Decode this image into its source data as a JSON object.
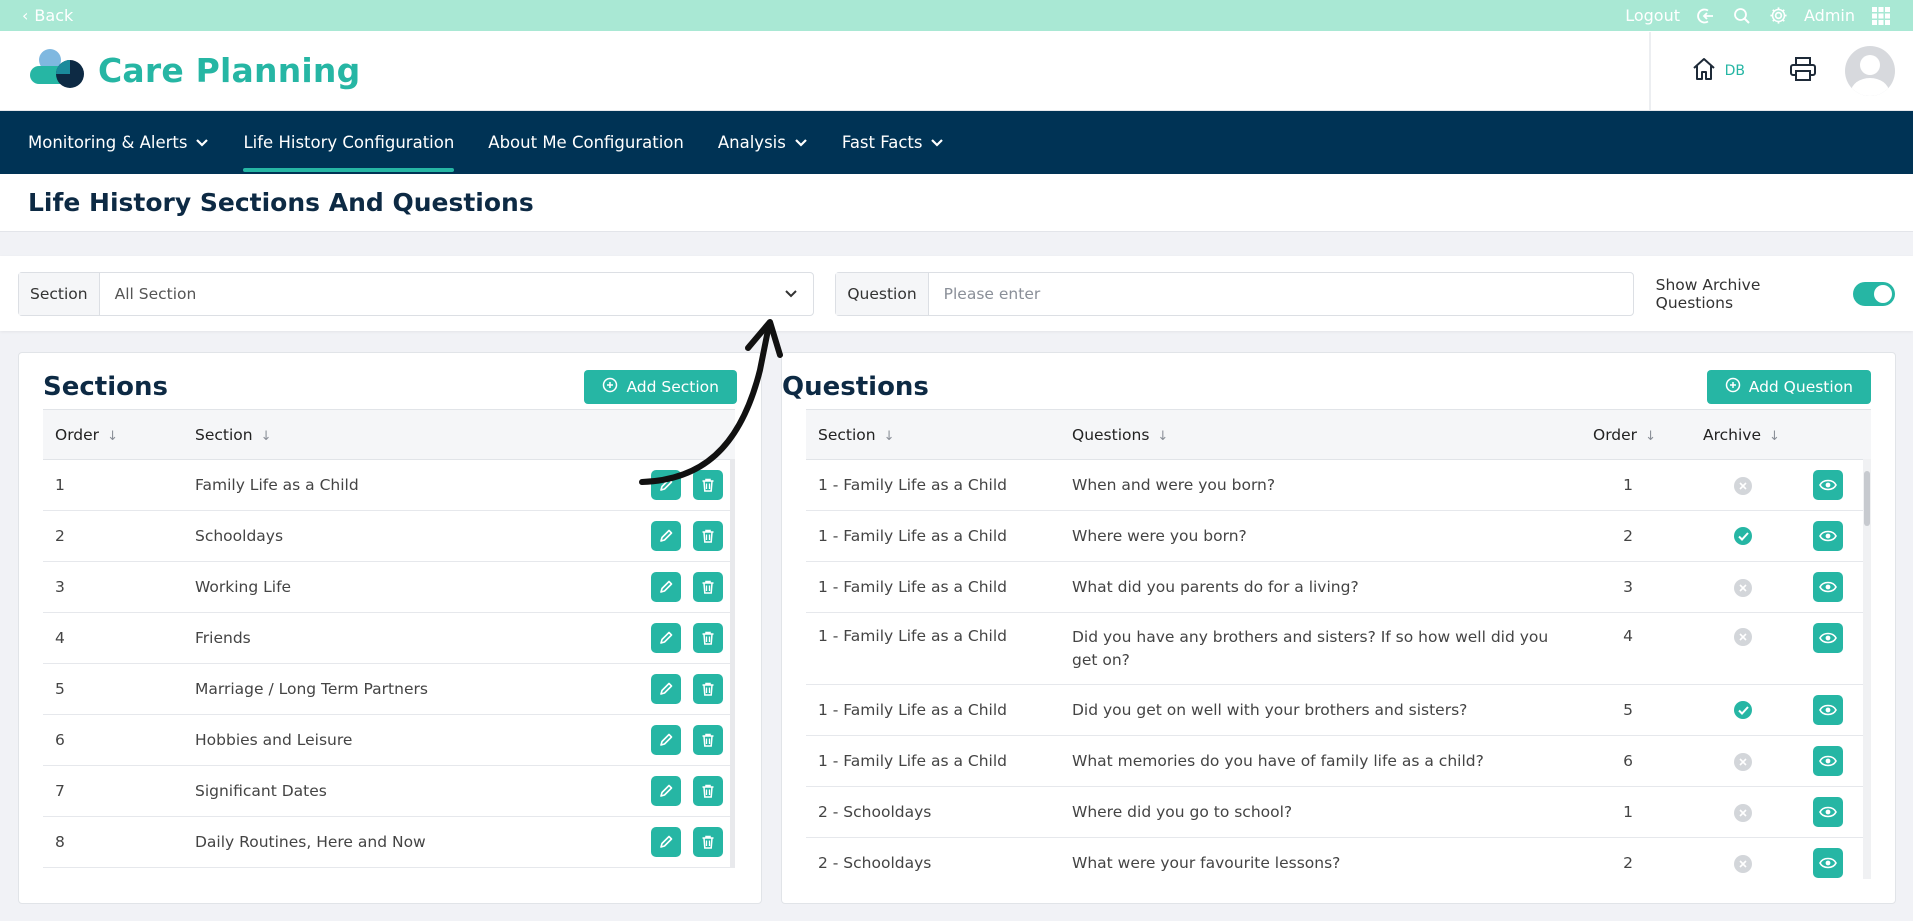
{
  "topbar": {
    "back_label": "Back",
    "logout_label": "Logout",
    "admin_label": "Admin"
  },
  "header": {
    "title": "Care Planning",
    "db_label": "DB"
  },
  "nav": [
    {
      "label": "Monitoring & Alerts",
      "dropdown": true,
      "active": false
    },
    {
      "label": "Life History Configuration",
      "dropdown": false,
      "active": true
    },
    {
      "label": "About Me Configuration",
      "dropdown": false,
      "active": false
    },
    {
      "label": "Analysis",
      "dropdown": true,
      "active": false
    },
    {
      "label": "Fast Facts",
      "dropdown": true,
      "active": false
    }
  ],
  "page": {
    "title": "Life History Sections And Questions"
  },
  "filters": {
    "section_label": "Section",
    "section_value": "All Section",
    "question_label": "Question",
    "question_placeholder": "Please enter",
    "archive_label": "Show Archive Questions",
    "archive_on": true
  },
  "sections_panel": {
    "title": "Sections",
    "add_label": "Add Section",
    "columns": [
      "Order",
      "Section"
    ],
    "rows": [
      {
        "order": "1",
        "section": "Family Life as a Child"
      },
      {
        "order": "2",
        "section": "Schooldays"
      },
      {
        "order": "3",
        "section": "Working Life"
      },
      {
        "order": "4",
        "section": "Friends"
      },
      {
        "order": "5",
        "section": "Marriage / Long Term Partners"
      },
      {
        "order": "6",
        "section": "Hobbies and Leisure"
      },
      {
        "order": "7",
        "section": "Significant Dates"
      },
      {
        "order": "8",
        "section": "Daily Routines, Here and Now"
      }
    ]
  },
  "questions_panel": {
    "title": "Questions",
    "add_label": "Add Question",
    "columns": [
      "Section",
      "Questions",
      "Order",
      "Archive"
    ],
    "rows": [
      {
        "section": "1 - Family Life as a Child",
        "question": "When and were you born?",
        "order": "1",
        "archived": false
      },
      {
        "section": "1 - Family Life as a Child",
        "question": "Where were you born?",
        "order": "2",
        "archived": true
      },
      {
        "section": "1 - Family Life as a Child",
        "question": "What did you parents do for a living?",
        "order": "3",
        "archived": false
      },
      {
        "section": "1 - Family Life as a Child",
        "question": "Did you have any brothers and sisters? If so how well did you get on?",
        "order": "4",
        "archived": false
      },
      {
        "section": "1 - Family Life as a Child",
        "question": "Did you get on well with your brothers and sisters?",
        "order": "5",
        "archived": true
      },
      {
        "section": "1 - Family Life as a Child",
        "question": "What memories do you have of family life as a child?",
        "order": "6",
        "archived": false
      },
      {
        "section": "2 - Schooldays",
        "question": "Where did you go to school?",
        "order": "1",
        "archived": false
      },
      {
        "section": "2 - Schooldays",
        "question": "What were your favourite lessons?",
        "order": "2",
        "archived": false
      }
    ]
  },
  "icons": {
    "edit": "pencil-icon",
    "delete": "trash-icon",
    "view": "eye-icon",
    "archived_yes": "check-icon",
    "archived_no": "x-icon"
  },
  "colors": {
    "accent": "#26b6a4",
    "nav_bg": "#003355",
    "topbar_bg": "#a9e8d4",
    "title_text": "#0d2a44"
  }
}
